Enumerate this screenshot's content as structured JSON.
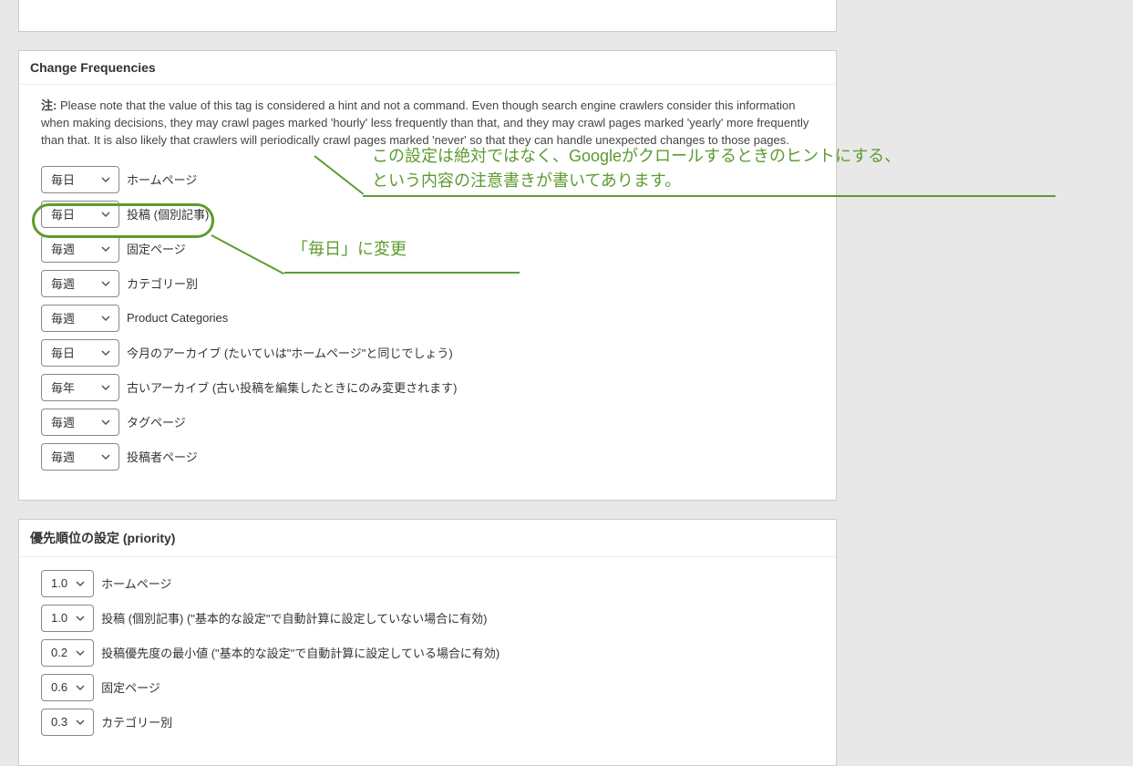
{
  "panels": {
    "change_freq": {
      "title": "Change Frequencies",
      "note_prefix": "注:",
      "note_text": " Please note that the value of this tag is considered a hint and not a command. Even though search engine crawlers consider this information when making decisions, they may crawl pages marked 'hourly' less frequently than that, and they may crawl pages marked 'yearly' more frequently than that. It is also likely that crawlers will periodically crawl pages marked 'never' so that they can handle unexpected changes to those pages.",
      "rows": [
        {
          "value": "毎日",
          "label": "ホームページ"
        },
        {
          "value": "毎日",
          "label": "投稿 (個別記事)"
        },
        {
          "value": "毎週",
          "label": "固定ページ"
        },
        {
          "value": "毎週",
          "label": "カテゴリー別"
        },
        {
          "value": "毎週",
          "label": "Product Categories"
        },
        {
          "value": "毎日",
          "label": "今月のアーカイブ (たいていは\"ホームページ\"と同じでしょう)"
        },
        {
          "value": "毎年",
          "label": "古いアーカイブ (古い投稿を編集したときにのみ変更されます)"
        },
        {
          "value": "毎週",
          "label": "タグページ"
        },
        {
          "value": "毎週",
          "label": "投稿者ページ"
        }
      ]
    },
    "priority": {
      "title": "優先順位の設定 (priority)",
      "rows": [
        {
          "value": "1.0",
          "label": "ホームページ"
        },
        {
          "value": "1.0",
          "label": "投稿 (個別記事) (\"基本的な設定\"で自動計算に設定していない場合に有効)"
        },
        {
          "value": "0.2",
          "label": "投稿優先度の最小値 (\"基本的な設定\"で自動計算に設定している場合に有効)"
        },
        {
          "value": "0.6",
          "label": "固定ページ"
        },
        {
          "value": "0.3",
          "label": "カテゴリー別"
        }
      ]
    }
  },
  "annotations": {
    "note_jp_line1": "この設定は絶対ではなく、Googleがクロールするときのヒントにする、",
    "note_jp_line2": "という内容の注意書きが書いてあります。",
    "change_label": "「毎日」に変更"
  }
}
